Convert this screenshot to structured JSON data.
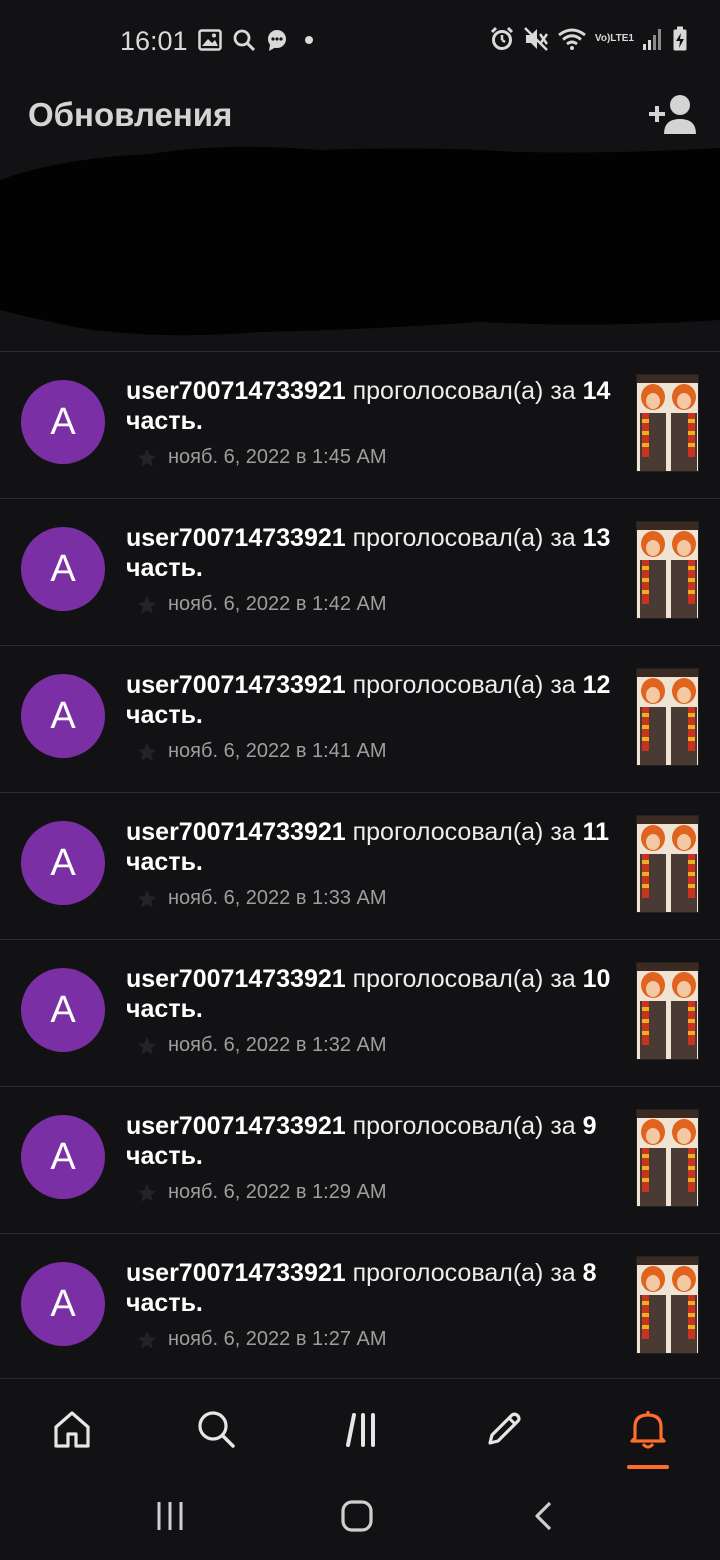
{
  "status_bar": {
    "time": "16:01",
    "network_label_top": "Vo)",
    "network_label_bottom": "LTE1",
    "left_icons": [
      "image-icon",
      "search-icon",
      "chat-notification-icon",
      "dot-icon"
    ],
    "right_icons": [
      "alarm-icon",
      "mute-icon",
      "wifi-icon",
      "volte-lte-icon",
      "signal-icon",
      "battery-charging-icon"
    ]
  },
  "header": {
    "title": "Обновления",
    "add_friend_icon": "add-person-icon"
  },
  "notifications": [
    {
      "user": "user700714733921",
      "action": "проголосовал(а) за",
      "part_number": "14",
      "part_word": "часть.",
      "time": "нояб. 6, 2022 в 1:45 AM",
      "avatar_letter": "A"
    },
    {
      "user": "user700714733921",
      "action": "проголосовал(а) за",
      "part_number": "13",
      "part_word": "часть.",
      "time": "нояб. 6, 2022 в 1:42 AM",
      "avatar_letter": "A"
    },
    {
      "user": "user700714733921",
      "action": "проголосовал(а) за",
      "part_number": "12",
      "part_word": "часть.",
      "time": "нояб. 6, 2022 в 1:41 AM",
      "avatar_letter": "A"
    },
    {
      "user": "user700714733921",
      "action": "проголосовал(а) за",
      "part_number": "11",
      "part_word": "часть.",
      "time": "нояб. 6, 2022 в 1:33 AM",
      "avatar_letter": "A"
    },
    {
      "user": "user700714733921",
      "action": "проголосовал(а) за",
      "part_number": "10",
      "part_word": "часть.",
      "time": "нояб. 6, 2022 в 1:32 AM",
      "avatar_letter": "A"
    },
    {
      "user": "user700714733921",
      "action": "проголосовал(а) за",
      "part_number": "9",
      "part_word": "часть.",
      "time": "нояб. 6, 2022 в 1:29 AM",
      "avatar_letter": "A"
    },
    {
      "user": "user700714733921",
      "action": "проголосовал(а) за",
      "part_number": "8",
      "part_word": "часть.",
      "time": "нояб. 6, 2022 в 1:27 AM",
      "avatar_letter": "A"
    }
  ],
  "bottom_nav": {
    "items": [
      "home-icon",
      "search-icon",
      "library-icon",
      "write-icon",
      "notifications-icon"
    ],
    "active": "notifications-icon"
  },
  "system_nav": [
    "recents-icon",
    "home-icon",
    "back-icon"
  ],
  "colors": {
    "background": "#121214",
    "avatar": "#7b2fa5",
    "accent": "#ff6d2c",
    "divider": "#2c2c2e"
  }
}
